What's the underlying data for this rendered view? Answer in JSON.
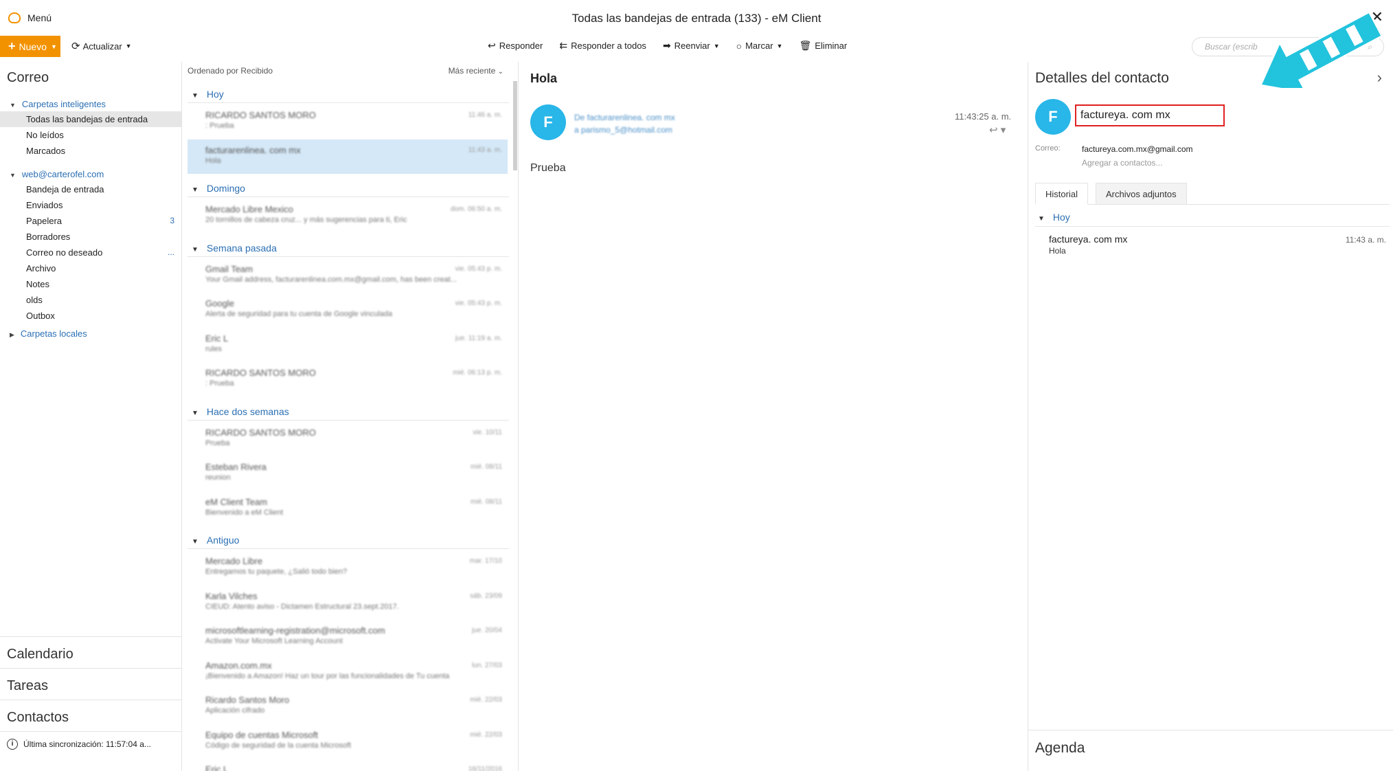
{
  "window": {
    "menu_label": "Menú",
    "title": "Todas las bandejas de entrada (133) - eM Client",
    "close_glyph": "✕"
  },
  "toolbar": {
    "new_label": "Nuevo",
    "update_label": "Actualizar",
    "reply_label": "Responder",
    "reply_all_label": "Responder a todos",
    "forward_label": "Reenviar",
    "mark_label": "Marcar",
    "delete_label": "Eliminar",
    "search_placeholder": "Buscar (escrib"
  },
  "sidebar": {
    "mail_title": "Correo",
    "smart_folders": "Carpetas inteligentes",
    "smart_items": [
      {
        "label": "Todas las bandejas de entrada"
      },
      {
        "label": "No leídos"
      },
      {
        "label": "Marcados"
      }
    ],
    "account": "web@carterofel.com",
    "account_items": [
      {
        "label": "Bandeja de entrada",
        "count": ""
      },
      {
        "label": "Enviados",
        "count": ""
      },
      {
        "label": "Papelera",
        "count": "3"
      },
      {
        "label": "Borradores",
        "count": ""
      },
      {
        "label": "Correo no deseado",
        "count": "..."
      },
      {
        "label": "Archivo",
        "count": ""
      },
      {
        "label": "Notes",
        "count": ""
      },
      {
        "label": "olds",
        "count": ""
      },
      {
        "label": "Outbox",
        "count": ""
      }
    ],
    "local_folders": "Carpetas locales",
    "calendar": "Calendario",
    "tasks": "Tareas",
    "contacts": "Contactos",
    "sync_status": "Última sincronización: 11:57:04 a..."
  },
  "message_list": {
    "sort_label": "Ordenado por Recibido",
    "sort_order": "Más reciente",
    "groups": [
      {
        "label": "Hoy",
        "messages": [
          {
            "from": "RICARDO SANTOS MORO",
            "subject": ": Prueba",
            "date": "11:46 a. m."
          },
          {
            "from": "facturarenlinea. com mx",
            "subject": "Hola",
            "date": "11:43 a. m."
          }
        ]
      },
      {
        "label": "Domingo",
        "messages": [
          {
            "from": "Mercado Libre Mexico",
            "subject": "20 tornillos de cabeza cruz... y más sugerencias para ti, Eric",
            "date": "dom. 06:50 a. m."
          }
        ]
      },
      {
        "label": "Semana pasada",
        "messages": [
          {
            "from": "Gmail Team",
            "subject": "Your Gmail address, facturarenlinea.com.mx@gmail.com, has been creat...",
            "date": "vie. 05:43 p. m."
          },
          {
            "from": "Google",
            "subject": "Alerta de seguridad para tu cuenta de Google vinculada",
            "date": "vie. 05:43 p. m."
          },
          {
            "from": "Eric L",
            "subject": "rules",
            "date": "jue. 11:19 a. m."
          },
          {
            "from": "RICARDO SANTOS MORO",
            "subject": ": Prueba",
            "date": "mié. 06:13 p. m."
          }
        ]
      },
      {
        "label": "Hace dos semanas",
        "messages": [
          {
            "from": "RICARDO SANTOS MORO",
            "subject": "Prueba",
            "date": "vie. 10/11"
          },
          {
            "from": "Esteban Rivera",
            "subject": "reunion",
            "date": "mié. 08/11"
          },
          {
            "from": "eM Client Team",
            "subject": "Bienvenido a eM Client",
            "date": "mié. 08/11"
          }
        ]
      },
      {
        "label": "Antiguo",
        "messages": [
          {
            "from": "Mercado Libre",
            "subject": "Entregamos tu paquete, ¿Salió todo bien?",
            "date": "mar. 17/10"
          },
          {
            "from": "Karla Vilches",
            "subject": "CIEUD: Atento aviso - Dictamen Estructural 23.sept.2017.",
            "date": "sáb. 23/09"
          },
          {
            "from": "microsoftlearning-registration@microsoft.com",
            "subject": "Activate Your Microsoft Learning Account",
            "date": "jue. 20/04"
          },
          {
            "from": "Amazon.com.mx",
            "subject": "¡Bienvenido a Amazon! Haz un tour por las funcionalidades de Tu cuenta",
            "date": "lun. 27/03"
          },
          {
            "from": "Ricardo Santos Moro",
            "subject": "Aplicación cifrado",
            "date": "mié. 22/03"
          },
          {
            "from": "Equipo de cuentas Microsoft",
            "subject": "Código de seguridad de la cuenta Microsoft",
            "date": "mié. 22/03"
          },
          {
            "from": "Eric L",
            "subject": "",
            "date": "16/11/2016"
          }
        ]
      }
    ]
  },
  "reader": {
    "subject": "Hola",
    "avatar_letter": "F",
    "from_line": "De facturarenlinea. com mx",
    "to_line": "a parismo_5@hotmail.com",
    "time": "11:43:25 a. m.",
    "body": "Prueba"
  },
  "contact": {
    "title": "Detalles del contacto",
    "avatar_letter": "F",
    "name": "factureya. com mx",
    "mail_label": "Correo:",
    "mail": "factureya.com.mx@gmail.com",
    "add_to_contacts": "Agregar a contactos...",
    "tab_history": "Historial",
    "tab_attachments": "Archivos adjuntos",
    "history_group": "Hoy",
    "history_name": "factureya. com mx",
    "history_subject": "Hola",
    "history_time": "11:43 a. m.",
    "agenda": "Agenda"
  },
  "colors": {
    "accent": "#f39200",
    "link": "#2b6fb3",
    "avatar": "#29b6e8",
    "selection": "#d5e8f7",
    "highlight_box": "#e02020",
    "annotation_arrow": "#22c3dd"
  }
}
